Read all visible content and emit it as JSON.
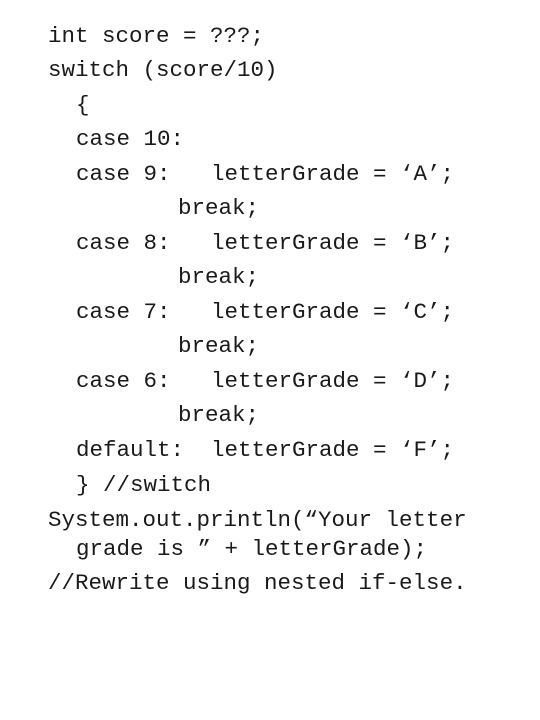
{
  "document": {
    "lines": [
      {
        "text": "int score = ???;"
      },
      {
        "text": "switch (score/10)"
      },
      {
        "text": "{"
      },
      {
        "text": "case 10:"
      },
      {
        "text": "case 9:   letterGrade = ‘A’;"
      },
      {
        "text": "break;"
      },
      {
        "text": "case 8:   letterGrade = ‘B’;"
      },
      {
        "text": "break;"
      },
      {
        "text": "case 7:   letterGrade = ‘C’;"
      },
      {
        "text": "break;"
      },
      {
        "text": "case 6:   letterGrade = ‘D’;"
      },
      {
        "text": "break;"
      },
      {
        "text": "default:  letterGrade = ‘F’;"
      },
      {
        "text": "} //switch"
      },
      {
        "text": "System.out.println(“Your letter"
      },
      {
        "text": "grade is ” + letterGrade);"
      },
      {
        "text": "//Rewrite using nested if-else."
      }
    ]
  }
}
